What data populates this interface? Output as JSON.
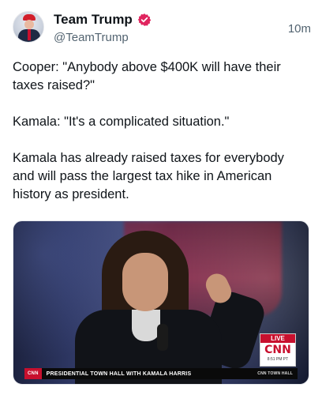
{
  "post": {
    "author": {
      "display_name": "Team Trump",
      "handle": "@TeamTrump",
      "verified_icon": "verified-badge-icon"
    },
    "timestamp": "10m",
    "paragraphs": [
      "Cooper: \"Anybody above $400K will have their taxes raised?\"",
      "Kamala: \"It's a complicated situation.\"",
      "Kamala has already raised taxes for everybody and will pass the largest tax hike in American history as president."
    ],
    "media": {
      "chyron_logo": "CNN",
      "chyron_text": "PRESIDENTIAL TOWN HALL WITH KAMALA HARRIS",
      "chyron_right": "CNN TOWN HALL",
      "bug_live": "LIVE",
      "bug_logo": "CNN",
      "bug_time": "8:51 PM PT"
    }
  },
  "colors": {
    "text": "#0f1419",
    "secondary": "#536471",
    "verified": "#e0245e",
    "cnn_red": "#c8102e"
  }
}
